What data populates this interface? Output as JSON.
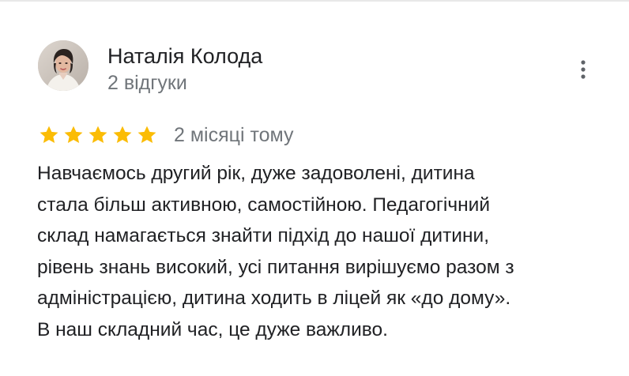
{
  "review": {
    "author": {
      "name": "Наталія Колода",
      "reviews_count": "2 відгуки",
      "avatar_icon": "user-photo"
    },
    "rating": {
      "stars": 5,
      "max": 5,
      "star_color": "#fbbc04",
      "empty_star_color": "#dadce0"
    },
    "time_ago": "2 місяці тому",
    "text_lines": [
      "Навчаємось другий рік, дуже задоволені, дитина",
      "стала більш активною, самостійною. Педагогічний",
      "склад намагається знайти підхід до нашої дитини,",
      "рівень знань високий, усі питання вирішуємо разом з",
      "адміністрацією, дитина ходить в ліцей як «до дому».",
      "В наш складний час, це дуже важливо."
    ],
    "more_icon": "more-vert-icon"
  }
}
